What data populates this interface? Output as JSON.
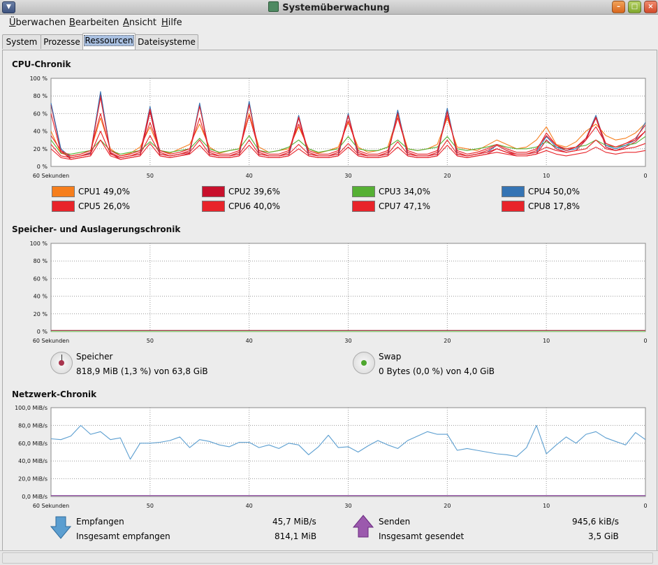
{
  "window": {
    "title": "Systemüberwachung"
  },
  "menubar": [
    {
      "underline": "Ü",
      "rest": "berwachen"
    },
    {
      "underline": "B",
      "rest": "earbeiten"
    },
    {
      "underline": "A",
      "rest": "nsicht"
    },
    {
      "underline": "H",
      "rest": "ilfe"
    }
  ],
  "tabs": [
    {
      "label": "System"
    },
    {
      "label": "Prozesse"
    },
    {
      "label": "Ressourcen"
    },
    {
      "label": "Dateisysteme"
    }
  ],
  "cpu": {
    "title": "CPU-Chronik",
    "legend": [
      {
        "label": "CPU1",
        "value": "49,0%",
        "color": "#f67e1c"
      },
      {
        "label": "CPU2",
        "value": "39,6%",
        "color": "#c8102c"
      },
      {
        "label": "CPU3",
        "value": "34,0%",
        "color": "#56b034"
      },
      {
        "label": "CPU4",
        "value": "50,0%",
        "color": "#3574b4"
      },
      {
        "label": "CPU5",
        "value": "26,0%",
        "color": "#e8242a"
      },
      {
        "label": "CPU6",
        "value": "40,0%",
        "color": "#e8242a"
      },
      {
        "label": "CPU7",
        "value": "47,1%",
        "color": "#e8242a"
      },
      {
        "label": "CPU8",
        "value": "17,8%",
        "color": "#e8242a"
      }
    ]
  },
  "memory": {
    "title": "Speicher- und Auslagerungschronik",
    "ram": {
      "label": "Speicher",
      "detail": "818,9 MiB (1,3 %) von 63,8 GiB",
      "color": "#a8344d"
    },
    "swap": {
      "label": "Swap",
      "detail": "0 Bytes (0,0 %) von 4,0 GiB",
      "color": "#4ea72e"
    }
  },
  "network": {
    "title": "Netzwerk-Chronik",
    "receiving_label": "Empfangen",
    "receiving_value": "45,7 MiB/s",
    "total_received_label": "Insgesamt empfangen",
    "total_received_value": "814,1 MiB",
    "sending_label": "Senden",
    "sending_value": "945,6 kiB/s",
    "total_sent_label": "Insgesamt gesendet",
    "total_sent_value": "3,5 GiB",
    "receive_color": "#5b9ed0",
    "send_color": "#8a3f9c"
  },
  "chart_data": [
    {
      "type": "line",
      "title": "CPU-Chronik",
      "x_ticks": [
        "60 Sekunden",
        "50",
        "40",
        "30",
        "20",
        "10",
        "0"
      ],
      "y_ticks": [
        "100 %",
        "80 %",
        "60 %",
        "40 %",
        "20 %",
        "0 %"
      ],
      "ylim": [
        0,
        100
      ],
      "grid": true,
      "x": [
        60,
        59,
        58,
        57,
        56,
        55,
        54,
        53,
        52,
        51,
        50,
        49,
        48,
        47,
        46,
        45,
        44,
        43,
        42,
        41,
        40,
        39,
        38,
        37,
        36,
        35,
        34,
        33,
        32,
        31,
        30,
        29,
        28,
        27,
        26,
        25,
        24,
        23,
        22,
        21,
        20,
        19,
        18,
        17,
        16,
        15,
        14,
        13,
        12,
        11,
        10,
        9,
        8,
        7,
        6,
        5,
        4,
        3,
        2,
        1,
        0
      ],
      "series": [
        {
          "name": "CPU1",
          "color": "#f67e1c",
          "values": [
            40,
            15,
            12,
            14,
            18,
            55,
            20,
            12,
            15,
            22,
            45,
            18,
            15,
            20,
            25,
            48,
            22,
            15,
            18,
            20,
            60,
            22,
            16,
            18,
            20,
            45,
            20,
            15,
            18,
            22,
            50,
            22,
            16,
            18,
            22,
            58,
            20,
            18,
            20,
            25,
            55,
            22,
            20,
            18,
            24,
            30,
            25,
            20,
            22,
            30,
            45,
            25,
            22,
            28,
            40,
            48,
            35,
            30,
            32,
            38,
            49
          ]
        },
        {
          "name": "CPU2",
          "color": "#c8102c",
          "values": [
            70,
            18,
            8,
            10,
            12,
            82,
            15,
            8,
            10,
            12,
            62,
            12,
            10,
            12,
            15,
            70,
            12,
            10,
            10,
            12,
            72,
            12,
            10,
            10,
            12,
            55,
            12,
            10,
            10,
            12,
            58,
            12,
            10,
            10,
            12,
            62,
            12,
            10,
            10,
            12,
            65,
            12,
            10,
            12,
            14,
            20,
            16,
            12,
            12,
            14,
            30,
            20,
            16,
            18,
            30,
            55,
            22,
            18,
            22,
            28,
            40
          ]
        },
        {
          "name": "CPU3",
          "color": "#56b034",
          "values": [
            30,
            15,
            14,
            16,
            18,
            30,
            18,
            14,
            16,
            18,
            28,
            18,
            16,
            18,
            20,
            32,
            20,
            16,
            18,
            20,
            35,
            18,
            16,
            18,
            22,
            30,
            20,
            16,
            18,
            20,
            34,
            20,
            18,
            18,
            22,
            30,
            20,
            18,
            20,
            22,
            34,
            20,
            18,
            20,
            22,
            25,
            22,
            20,
            20,
            22,
            28,
            22,
            20,
            22,
            24,
            30,
            24,
            22,
            24,
            26,
            34
          ]
        },
        {
          "name": "CPU4",
          "color": "#3574b4",
          "values": [
            72,
            20,
            10,
            12,
            15,
            85,
            16,
            10,
            12,
            14,
            68,
            14,
            12,
            14,
            16,
            72,
            14,
            12,
            12,
            14,
            74,
            14,
            12,
            12,
            14,
            58,
            14,
            12,
            12,
            14,
            60,
            14,
            12,
            12,
            14,
            64,
            14,
            12,
            12,
            14,
            66,
            14,
            12,
            14,
            16,
            24,
            18,
            14,
            14,
            16,
            34,
            22,
            18,
            20,
            32,
            58,
            24,
            20,
            24,
            30,
            50
          ]
        },
        {
          "name": "CPU5",
          "color": "#e8242a",
          "values": [
            25,
            12,
            10,
            12,
            14,
            40,
            14,
            10,
            12,
            14,
            35,
            14,
            12,
            14,
            16,
            30,
            14,
            12,
            12,
            14,
            30,
            14,
            12,
            12,
            14,
            25,
            14,
            12,
            12,
            14,
            26,
            14,
            12,
            12,
            14,
            28,
            14,
            12,
            12,
            14,
            30,
            14,
            12,
            14,
            16,
            20,
            16,
            14,
            14,
            16,
            22,
            18,
            16,
            18,
            20,
            30,
            20,
            18,
            20,
            22,
            26
          ]
        },
        {
          "name": "CPU6",
          "color": "#e8242a",
          "values": [
            35,
            18,
            12,
            14,
            18,
            60,
            18,
            12,
            14,
            18,
            50,
            18,
            14,
            16,
            20,
            55,
            18,
            14,
            14,
            18,
            58,
            18,
            14,
            14,
            18,
            48,
            18,
            14,
            14,
            18,
            52,
            18,
            14,
            14,
            18,
            55,
            18,
            14,
            14,
            18,
            58,
            18,
            14,
            16,
            20,
            25,
            20,
            16,
            16,
            20,
            35,
            24,
            20,
            22,
            30,
            45,
            26,
            22,
            26,
            30,
            40
          ]
        },
        {
          "name": "CPU7",
          "color": "#e8242a",
          "values": [
            60,
            16,
            10,
            12,
            16,
            78,
            16,
            10,
            12,
            16,
            65,
            16,
            12,
            14,
            18,
            68,
            16,
            12,
            12,
            16,
            70,
            16,
            12,
            12,
            16,
            56,
            16,
            12,
            12,
            16,
            58,
            16,
            12,
            12,
            16,
            60,
            16,
            12,
            12,
            16,
            62,
            16,
            12,
            14,
            18,
            24,
            18,
            14,
            14,
            18,
            38,
            24,
            18,
            22,
            32,
            56,
            26,
            22,
            26,
            32,
            47
          ]
        },
        {
          "name": "CPU8",
          "color": "#e8242a",
          "values": [
            20,
            10,
            8,
            10,
            12,
            30,
            12,
            8,
            10,
            12,
            26,
            12,
            10,
            12,
            14,
            24,
            12,
            10,
            10,
            12,
            24,
            12,
            10,
            10,
            12,
            20,
            12,
            10,
            10,
            12,
            22,
            12,
            10,
            10,
            12,
            22,
            12,
            10,
            10,
            12,
            24,
            12,
            10,
            12,
            14,
            16,
            14,
            12,
            12,
            14,
            18,
            14,
            12,
            14,
            16,
            22,
            16,
            14,
            16,
            16,
            18
          ]
        }
      ]
    },
    {
      "type": "line",
      "title": "Speicher- und Auslagerungschronik",
      "x_ticks": [
        "60 Sekunden",
        "50",
        "40",
        "30",
        "20",
        "10",
        "0"
      ],
      "y_ticks": [
        "100 %",
        "80 %",
        "60 %",
        "40 %",
        "20 %",
        "0 %"
      ],
      "ylim": [
        0,
        100
      ],
      "grid": true,
      "x": [
        60,
        0
      ],
      "series": [
        {
          "name": "Speicher",
          "color": "#a8344d",
          "values": [
            1.3,
            1.3
          ]
        },
        {
          "name": "Swap",
          "color": "#4ea72e",
          "values": [
            0,
            0
          ]
        }
      ]
    },
    {
      "type": "line",
      "title": "Netzwerk-Chronik",
      "x_ticks": [
        "60 Sekunden",
        "50",
        "40",
        "30",
        "20",
        "10",
        "0"
      ],
      "y_ticks": [
        "100,0 MiB/s",
        "80,0 MiB/s",
        "60,0 MiB/s",
        "40,0 MiB/s",
        "20,0 MiB/s",
        "0,0 MiB/s"
      ],
      "ylim": [
        0,
        100
      ],
      "grid": true,
      "x": [
        60,
        59,
        58,
        57,
        56,
        55,
        54,
        53,
        52,
        51,
        50,
        49,
        48,
        47,
        46,
        45,
        44,
        43,
        42,
        41,
        40,
        39,
        38,
        37,
        36,
        35,
        34,
        33,
        32,
        31,
        30,
        29,
        28,
        27,
        26,
        25,
        24,
        23,
        22,
        21,
        20,
        19,
        18,
        17,
        16,
        15,
        14,
        13,
        12,
        11,
        10,
        9,
        8,
        7,
        6,
        5,
        4,
        3,
        2,
        1,
        0
      ],
      "series": [
        {
          "name": "Empfangen",
          "color": "#5b9ed0",
          "values": [
            65,
            64,
            68,
            80,
            70,
            73,
            64,
            66,
            42,
            60,
            60,
            61,
            63,
            67,
            55,
            64,
            62,
            58,
            56,
            61,
            61,
            55,
            58,
            54,
            60,
            58,
            47,
            56,
            69,
            55,
            56,
            50,
            57,
            63,
            58,
            54,
            63,
            68,
            73,
            70,
            70,
            52,
            54,
            52,
            50,
            48,
            47,
            45,
            55,
            80,
            48,
            58,
            67,
            60,
            70,
            73,
            66,
            62,
            58,
            72,
            64
          ]
        },
        {
          "name": "Senden",
          "color": "#8a3f9c",
          "values": [
            1,
            1,
            1,
            1,
            1,
            1,
            1,
            1,
            1,
            1,
            1,
            1,
            1,
            1,
            1,
            1,
            1,
            1,
            1,
            1,
            1,
            1,
            1,
            1,
            1,
            1,
            1,
            1,
            1,
            1,
            1,
            1,
            1,
            1,
            1,
            1,
            1,
            1,
            1,
            1,
            1,
            1,
            1,
            1,
            1,
            1,
            1,
            1,
            1,
            1,
            1,
            1,
            1,
            1,
            1,
            1,
            1,
            1,
            1,
            1,
            1
          ]
        }
      ]
    }
  ]
}
